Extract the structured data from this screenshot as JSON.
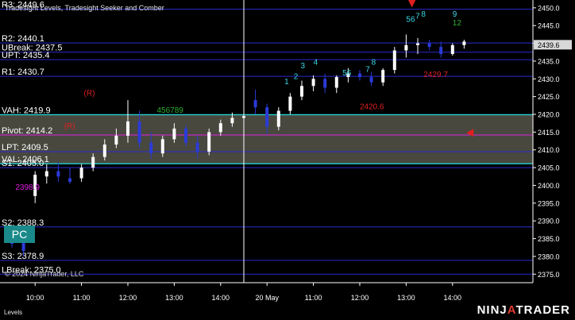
{
  "header": {
    "subtitle": "Tradesight Levels, Tradesight Seeker and Comber",
    "copyright": "© 2024 NinjaTrader, LLC",
    "panel_label": "Levels",
    "badge": "PC",
    "brand_main": "NINJ",
    "brand_accent": "A",
    "brand_tail": "TRADER"
  },
  "colors": {
    "background": "#000000",
    "up_candle": "#ffffff",
    "down_candle": "#2b3bd8",
    "level_line": "#2a2acf",
    "value_area_fill": "#55554a",
    "value_area_border": "#25d0d0",
    "resistance_line": "#b01818",
    "magenta": "#e020e0",
    "green_count": "#2fae2f",
    "cyan_count": "#3ad8e8",
    "red_mark": "#e02020"
  },
  "chart_data": {
    "type": "candlestick",
    "title": "",
    "ylim": [
      2372.6,
      2452.2
    ],
    "y_ticks": [
      2375.0,
      2380.0,
      2385.0,
      2390.0,
      2395.0,
      2400.0,
      2405.0,
      2410.0,
      2415.0,
      2420.0,
      2425.0,
      2430.0,
      2435.0,
      2440.0,
      2445.0,
      2450.0
    ],
    "y_tick_labels": [
      "2375.0",
      "2380.0",
      "2385.0",
      "2390.0",
      "2395.0",
      "2400.0",
      "2405.0",
      "2410.0",
      "2415.0",
      "2420.0",
      "2425.0",
      "2430.0",
      "2435.0",
      "2440.0",
      "2445.0",
      "2450.0"
    ],
    "x_ticks": [
      {
        "label": "10:00",
        "slot": 2.0
      },
      {
        "label": "11:00",
        "slot": 6.0
      },
      {
        "label": "12:00",
        "slot": 10.0
      },
      {
        "label": "13:00",
        "slot": 14.0
      },
      {
        "label": "14:00",
        "slot": 18.0
      },
      {
        "label": "20 May",
        "slot": 22.0
      },
      {
        "label": "11:00",
        "slot": 26.0
      },
      {
        "label": "12:00",
        "slot": 30.0
      },
      {
        "label": "13:00",
        "slot": 34.0
      },
      {
        "label": "14:00",
        "slot": 38.0
      }
    ],
    "session_break_slot": 20.0,
    "price_levels": [
      {
        "name": "R3",
        "label": "R3: 2449.6",
        "value": 2449.6,
        "color": "#2a2acf"
      },
      {
        "name": "R2",
        "label": "R2: 2440.1",
        "value": 2440.1,
        "color": "#2a2acf"
      },
      {
        "name": "UBreak",
        "label": "UBreak: 2437.5",
        "value": 2437.5,
        "color": "#2a2acf"
      },
      {
        "name": "UPT",
        "label": "UPT: 2435.4",
        "value": 2435.4,
        "color": "#2a2acf"
      },
      {
        "name": "R1",
        "label": "R1: 2430.7",
        "value": 2430.7,
        "color": "#2a2acf"
      },
      {
        "name": "VAH",
        "label": "VAH: 2419.9",
        "value": 2419.9,
        "color": "#25d0d0"
      },
      {
        "name": "Pivot",
        "label": "Pivot: 2414.2",
        "value": 2414.2,
        "color": "#e020e0"
      },
      {
        "name": "LPT",
        "label": "LPT: 2409.5",
        "value": 2409.5,
        "color": "#2a2acf"
      },
      {
        "name": "VAL",
        "label": "VAL: 2406.1",
        "value": 2406.1,
        "color": "#25d0d0"
      },
      {
        "name": "S1",
        "label": "S1: 2405.0",
        "value": 2405.0,
        "color": "#2a2acf"
      },
      {
        "name": "S2",
        "label": "S2: 2388.3",
        "value": 2388.3,
        "color": "#2a2acf"
      },
      {
        "name": "S3",
        "label": "S3: 2378.9",
        "value": 2378.9,
        "color": "#2a2acf"
      },
      {
        "name": "LBreak",
        "label": "LBreak: 2375.0",
        "value": 2375.0,
        "color": "#2a2acf"
      }
    ],
    "value_area": {
      "high": 2419.9,
      "low": 2406.1
    },
    "current_price": {
      "value": 2439.6,
      "label": "2439.6"
    },
    "candles": [
      {
        "open": 2386.0,
        "high": 2387.0,
        "low": 2382.5,
        "close": 2383.5
      },
      {
        "open": 2384.0,
        "high": 2385.5,
        "low": 2380.0,
        "close": 2381.5
      },
      {
        "open": 2397.0,
        "high": 2404.0,
        "low": 2395.0,
        "close": 2403.0
      },
      {
        "open": 2402.5,
        "high": 2406.0,
        "low": 2400.5,
        "close": 2404.0
      },
      {
        "open": 2404.0,
        "high": 2406.5,
        "low": 2401.0,
        "close": 2402.5
      },
      {
        "open": 2402.0,
        "high": 2405.0,
        "low": 2400.5,
        "close": 2401.0
      },
      {
        "open": 2402.0,
        "high": 2406.0,
        "low": 2401.0,
        "close": 2405.0
      },
      {
        "open": 2405.0,
        "high": 2409.0,
        "low": 2404.0,
        "close": 2408.0
      },
      {
        "open": 2408.0,
        "high": 2413.0,
        "low": 2407.0,
        "close": 2411.5
      },
      {
        "open": 2411.5,
        "high": 2416.0,
        "low": 2410.5,
        "close": 2414.0
      },
      {
        "open": 2414.0,
        "high": 2424.0,
        "low": 2412.0,
        "close": 2418.0
      },
      {
        "open": 2418.0,
        "high": 2421.0,
        "low": 2410.5,
        "close": 2412.0
      },
      {
        "open": 2412.0,
        "high": 2415.0,
        "low": 2407.5,
        "close": 2409.0
      },
      {
        "open": 2409.0,
        "high": 2414.0,
        "low": 2408.0,
        "close": 2413.0
      },
      {
        "open": 2413.0,
        "high": 2417.5,
        "low": 2412.0,
        "close": 2416.0
      },
      {
        "open": 2416.0,
        "high": 2417.0,
        "low": 2411.0,
        "close": 2412.0
      },
      {
        "open": 2412.0,
        "high": 2414.0,
        "low": 2407.5,
        "close": 2409.5
      },
      {
        "open": 2409.5,
        "high": 2416.0,
        "low": 2408.5,
        "close": 2415.0
      },
      {
        "open": 2415.0,
        "high": 2418.5,
        "low": 2414.0,
        "close": 2417.5
      },
      {
        "open": 2417.5,
        "high": 2420.5,
        "low": 2416.5,
        "close": 2419.0
      },
      {
        "open": 2419.0,
        "high": 2420.5,
        "low": 2417.5,
        "close": 2419.5
      },
      {
        "open": 2424.0,
        "high": 2427.0,
        "low": 2420.0,
        "close": 2422.0
      },
      {
        "open": 2422.0,
        "high": 2423.0,
        "low": 2414.5,
        "close": 2416.5
      },
      {
        "open": 2416.5,
        "high": 2422.0,
        "low": 2415.5,
        "close": 2421.0
      },
      {
        "open": 2421.0,
        "high": 2426.0,
        "low": 2420.0,
        "close": 2425.0
      },
      {
        "open": 2425.0,
        "high": 2429.5,
        "low": 2424.0,
        "close": 2428.0
      },
      {
        "open": 2428.0,
        "high": 2431.0,
        "low": 2426.5,
        "close": 2430.0
      },
      {
        "open": 2430.0,
        "high": 2431.5,
        "low": 2426.0,
        "close": 2427.5
      },
      {
        "open": 2427.5,
        "high": 2431.0,
        "low": 2426.0,
        "close": 2430.5
      },
      {
        "open": 2430.5,
        "high": 2433.0,
        "low": 2429.0,
        "close": 2431.5
      },
      {
        "open": 2431.5,
        "high": 2432.5,
        "low": 2429.5,
        "close": 2430.5
      },
      {
        "open": 2430.5,
        "high": 2432.0,
        "low": 2428.0,
        "close": 2429.0
      },
      {
        "open": 2429.0,
        "high": 2433.0,
        "low": 2428.0,
        "close": 2432.5
      },
      {
        "open": 2432.5,
        "high": 2439.0,
        "low": 2431.5,
        "close": 2438.0
      },
      {
        "open": 2438.0,
        "high": 2442.5,
        "low": 2436.0,
        "close": 2439.5
      },
      {
        "open": 2439.5,
        "high": 2441.5,
        "low": 2437.0,
        "close": 2440.0
      },
      {
        "open": 2440.0,
        "high": 2441.0,
        "low": 2438.0,
        "close": 2439.0
      },
      {
        "open": 2439.0,
        "high": 2440.5,
        "low": 2436.0,
        "close": 2437.0
      },
      {
        "open": 2437.0,
        "high": 2440.0,
        "low": 2436.5,
        "close": 2439.5
      },
      {
        "open": 2439.5,
        "high": 2441.0,
        "low": 2438.5,
        "close": 2440.5
      }
    ],
    "annotations": [
      {
        "text": "(R)",
        "slot": 6.2,
        "price": 2425.3,
        "color": "#e02020"
      },
      {
        "text": "(R)",
        "slot": 4.5,
        "price": 2416.0,
        "color": "#e02020"
      },
      {
        "text": "456789",
        "slot": 12.5,
        "price": 2420.5,
        "color": "#2fae2f"
      },
      {
        "text": "2398.9",
        "slot": 0.3,
        "price": 2398.8,
        "color": "#e020e0"
      },
      {
        "text": "1",
        "slot": 23.5,
        "price": 2428.5,
        "color": "#3ad8e8"
      },
      {
        "text": "2",
        "slot": 24.3,
        "price": 2430.0,
        "color": "#3ad8e8"
      },
      {
        "text": "3",
        "slot": 24.9,
        "price": 2433.0,
        "color": "#3ad8e8"
      },
      {
        "text": "4",
        "slot": 26.0,
        "price": 2434.0,
        "color": "#3ad8e8"
      },
      {
        "text": "56",
        "slot": 28.5,
        "price": 2431.0,
        "color": "#3ad8e8"
      },
      {
        "text": "7",
        "slot": 30.5,
        "price": 2432.0,
        "color": "#3ad8e8"
      },
      {
        "text": "8",
        "slot": 31.0,
        "price": 2434.0,
        "color": "#3ad8e8"
      },
      {
        "text": "56",
        "slot": 34.0,
        "price": 2446.0,
        "color": "#3ad8e8"
      },
      {
        "text": "7",
        "slot": 34.8,
        "price": 2447.0,
        "color": "#3ad8e8"
      },
      {
        "text": "8",
        "slot": 35.3,
        "price": 2447.5,
        "color": "#3ad8e8"
      },
      {
        "text": "9",
        "slot": 38.0,
        "price": 2447.5,
        "color": "#3ad8e8"
      },
      {
        "text": "12",
        "slot": 38.0,
        "price": 2445.0,
        "color": "#2fae2f"
      },
      {
        "text": "2420.6",
        "slot": 30.0,
        "price": 2421.5,
        "color": "#e02020"
      },
      {
        "text": "2429.7",
        "slot": 35.5,
        "price": 2430.5,
        "color": "#e02020"
      }
    ],
    "signal_arrows": [
      {
        "slot": 34.5,
        "price": 2451.0,
        "direction": "down",
        "color": "#e02020"
      },
      {
        "slot": 39.4,
        "price": 2414.8,
        "direction": "left",
        "color": "#e02020"
      }
    ]
  }
}
